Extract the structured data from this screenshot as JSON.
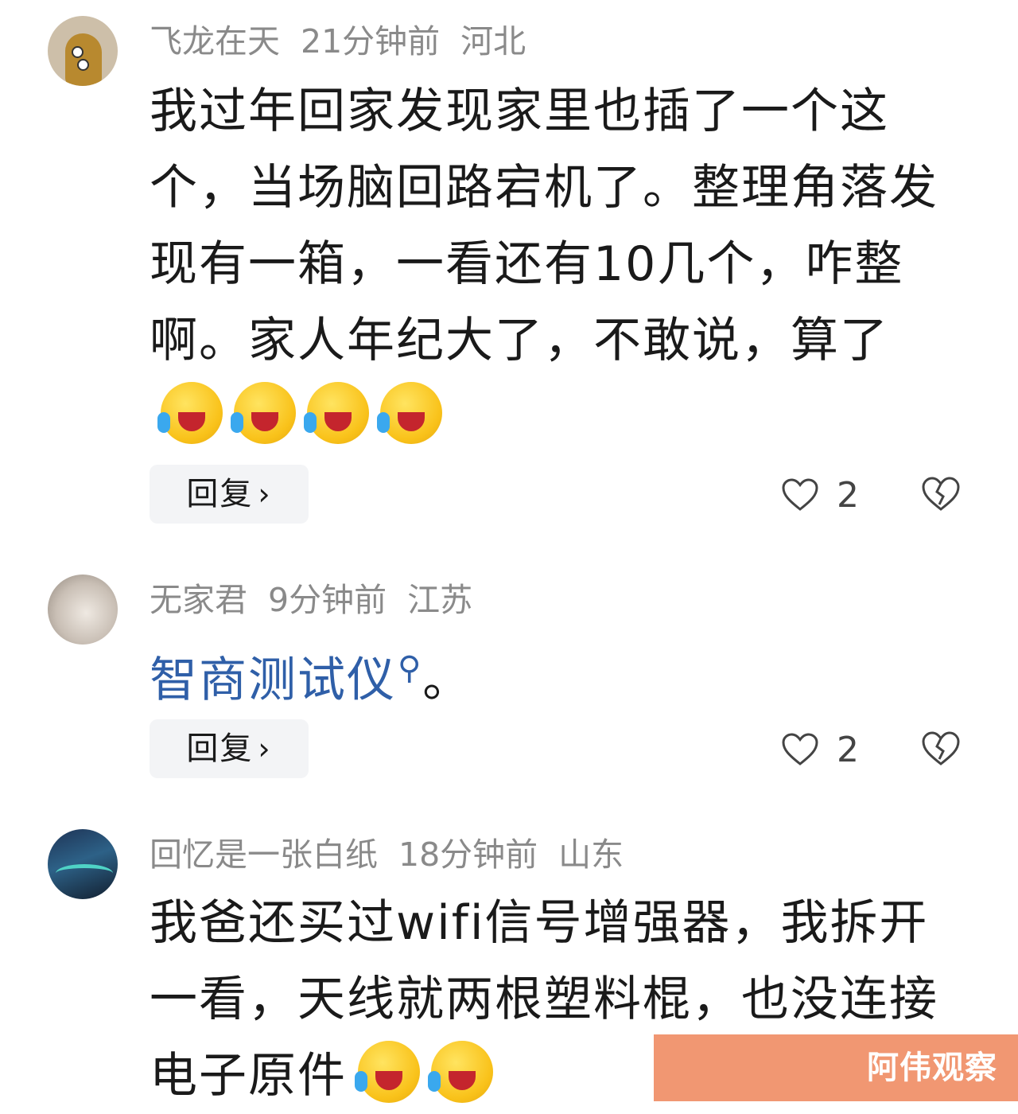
{
  "comments": [
    {
      "username": "飞龙在天",
      "time": "21分钟前",
      "location": "河北",
      "text": "我过年回家发现家里也插了一个这个，当场脑回路宕机了。整理角落发现有一箱，一看还有10几个，咋整啊。家人年纪大了，不敢说，算了",
      "emoji_icons": [
        "laughing-crying-icon",
        "laughing-crying-icon",
        "laughing-crying-icon",
        "laughing-crying-icon"
      ],
      "reply_label": "回复",
      "likes": "2"
    },
    {
      "username": "无家君",
      "time": "9分钟前",
      "location": "江苏",
      "link_text": "智商测试仪",
      "suffix": "。",
      "reply_label": "回复",
      "likes": "2"
    },
    {
      "username": "回忆是一张白纸",
      "time": "18分钟前",
      "location": "山东",
      "text": "我爸还买过wifi信号增强器，我拆开一看，天线就两根塑料棍，也没连接电子原件",
      "emoji_icons": [
        "laughing-crying-icon",
        "laughing-crying-icon"
      ]
    }
  ],
  "watermark": "阿伟观察",
  "colors": {
    "meta_text": "#8a8a8a",
    "link": "#2f5fa8",
    "reply_bg": "#f3f4f6",
    "watermark_bg": "#f19772"
  }
}
